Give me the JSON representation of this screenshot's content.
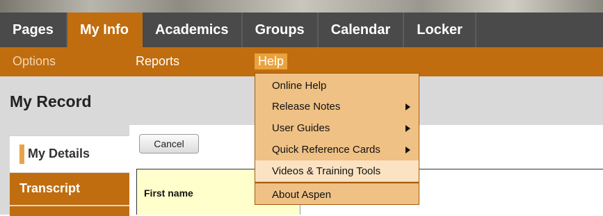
{
  "top_nav": {
    "tabs": [
      "Pages",
      "My Info",
      "Academics",
      "Groups",
      "Calendar",
      "Locker"
    ],
    "active": "My Info"
  },
  "sub_nav": {
    "options": "Options",
    "reports": "Reports",
    "help": "Help"
  },
  "page": {
    "title": "My Record"
  },
  "left_nav": {
    "active_tab": "My Details",
    "transcript_tab": "Transcript"
  },
  "toolbar": {
    "cancel_label": "Cancel"
  },
  "form": {
    "first_name_label": "First name"
  },
  "help_menu": {
    "items": [
      {
        "label": "Online Help",
        "submenu": false
      },
      {
        "label": "Release Notes",
        "submenu": true
      },
      {
        "label": "User Guides",
        "submenu": true
      },
      {
        "label": "Quick Reference Cards",
        "submenu": true
      },
      {
        "label": "Videos & Training Tools",
        "submenu": false,
        "highlighted": true
      },
      {
        "label": "About Aspen",
        "submenu": false
      }
    ]
  },
  "colors": {
    "nav_dark": "#4a4a4a",
    "accent_orange": "#c06d0f",
    "menu_bg": "#efc185",
    "menu_highlight": "#fbe2c2",
    "help_active": "#e9a23d",
    "form_label_bg": "#ffffcc"
  }
}
